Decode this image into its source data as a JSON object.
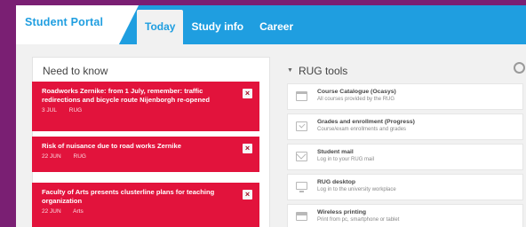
{
  "header": {
    "brand": "Student Portal",
    "tabs": [
      {
        "label": "Today",
        "active": true
      },
      {
        "label": "Study info",
        "active": false
      },
      {
        "label": "Career",
        "active": false
      }
    ],
    "color": "#1f9ee0"
  },
  "need_to_know": {
    "title": "Need to know",
    "items": [
      {
        "title": "Roadworks Zernike: from 1 July, remember: traffic redirections and bicycle route Nijenborgh re-opened",
        "time": "3 JUL",
        "source": "RUG"
      },
      {
        "title": "Risk of nuisance due to road works Zernike",
        "time": "22 JUN",
        "source": "RUG"
      },
      {
        "title": "Faculty of Arts presents clusterline plans for teaching organization",
        "time": "22 JUN",
        "source": "Arts"
      }
    ],
    "color": "#e2133c"
  },
  "rug_tools": {
    "title": "RUG tools",
    "items": [
      {
        "name": "Course Catalogue (Ocasys)",
        "desc": "All courses provided by the RUG",
        "icon": "document-icon"
      },
      {
        "name": "Grades and enrollment (Progress)",
        "desc": "Course/exam enrollments and grades",
        "icon": "checklist-icon"
      },
      {
        "name": "Student mail",
        "desc": "Log in to your RUG mail",
        "icon": "mail-icon"
      },
      {
        "name": "RUG desktop",
        "desc": "Log in to the university workplace",
        "icon": "monitor-icon"
      },
      {
        "name": "Wireless printing",
        "desc": "Print from pc, smartphone or tablet",
        "icon": "printer-icon"
      }
    ]
  }
}
